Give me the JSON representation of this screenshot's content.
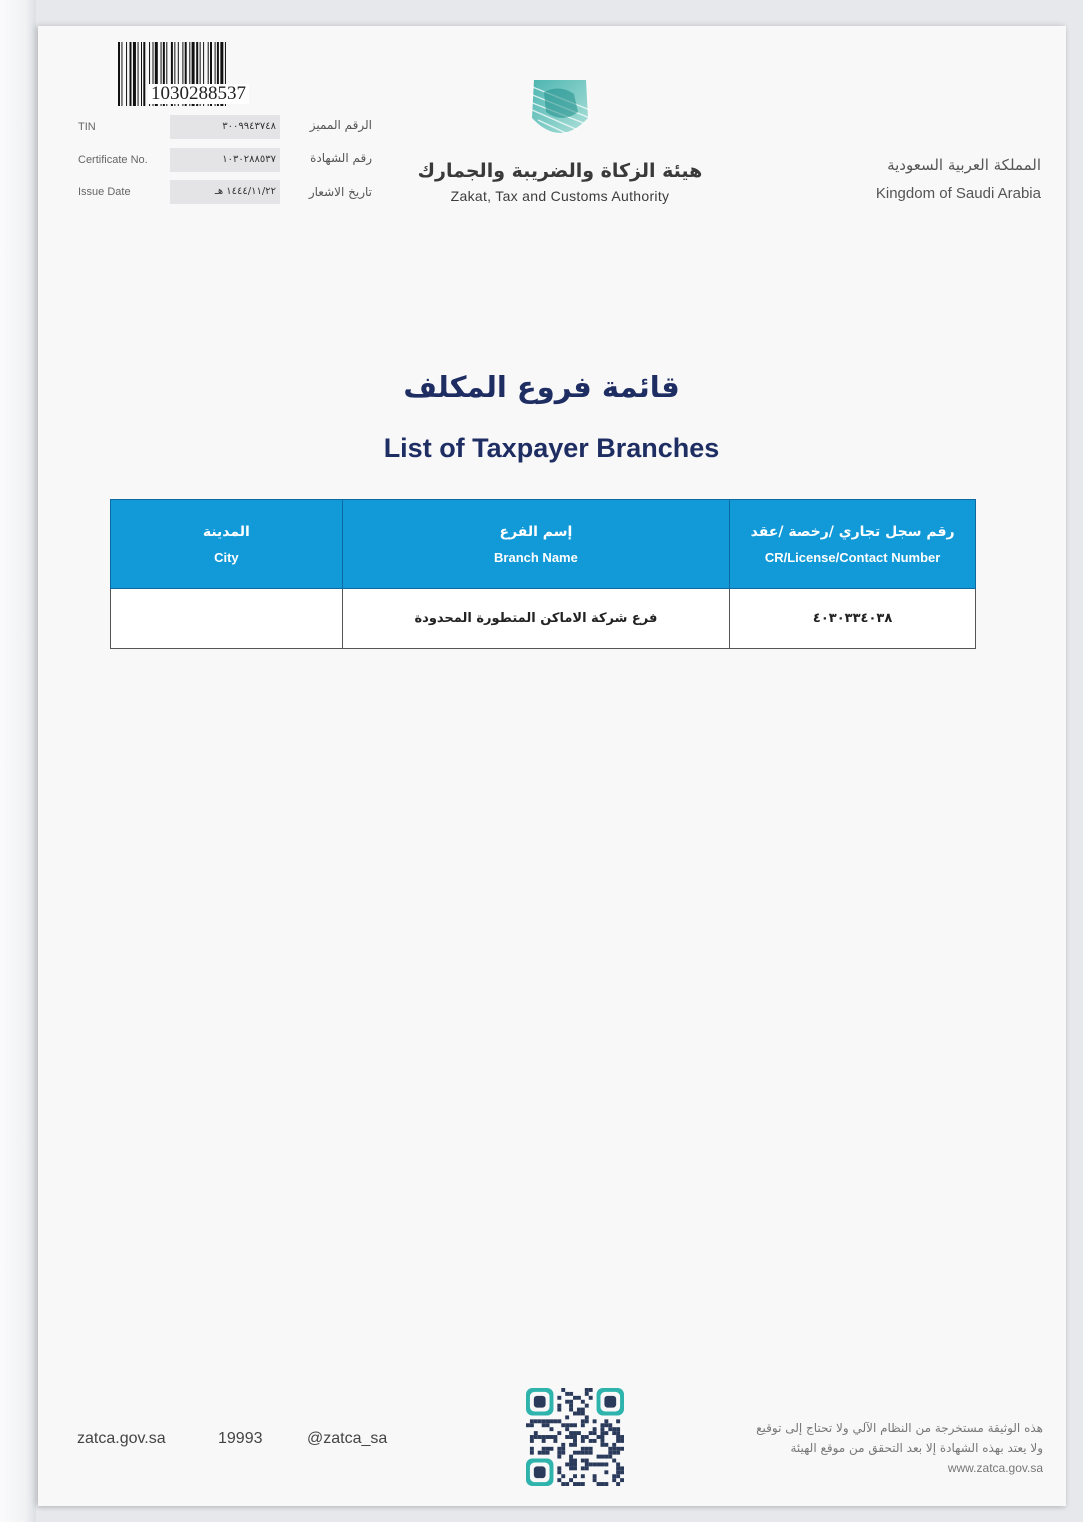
{
  "barcode": {
    "number": "1030288537"
  },
  "info": [
    {
      "label_en": "TIN",
      "value": "٣٠٠٩٩٤٣٧٤٨",
      "label_ar": "الرقم المميز"
    },
    {
      "label_en": "Certificate No.",
      "value": "١٠٣٠٢٨٨٥٣٧",
      "label_ar": "رقم الشهادة"
    },
    {
      "label_en": "Issue Date",
      "value": "١٤٤٤/١١/٢٢ هـ",
      "label_ar": "تاريخ الاشعار"
    }
  ],
  "header": {
    "org_ar": "هيئة الزكاة والضريبة والجمارك",
    "org_en": "Zakat, Tax and Customs Authority",
    "ksa_ar": "المملكة العربية السعودية",
    "ksa_en": "Kingdom of Saudi Arabia"
  },
  "title": {
    "ar": "قائمة فروع المكلف",
    "en": "List of Taxpayer Branches"
  },
  "table": {
    "headers": [
      {
        "ar": "المدينة",
        "en": "City"
      },
      {
        "ar": "إسم الفرع",
        "en": "Branch Name"
      },
      {
        "ar": "رقم سجل تجاري /رخصة /عقد",
        "en": "CR/License/Contact Number"
      }
    ],
    "rows": [
      {
        "city": "",
        "branch_name": "فرع شركة الاماكن المتطورة المحدودة",
        "cr_number": "٤٠٣٠٣٣٤٠٣٨"
      }
    ]
  },
  "footer": {
    "website": "zatca.gov.sa",
    "phone": "19993",
    "social": "@zatca_sa",
    "note_line1": "هذه الوثيقة مستخرجة من النظام الآلي ولا تحتاج إلى توقيع",
    "note_line2": "ولا يعتد بهذه الشهادة إلا بعد التحقق من موقع الهيئة",
    "note_web": "www.zatca.gov.sa"
  },
  "colors": {
    "header_blue": "#1199d8",
    "title_navy": "#1e2d62",
    "logo_teal": "#3fb8b0"
  }
}
